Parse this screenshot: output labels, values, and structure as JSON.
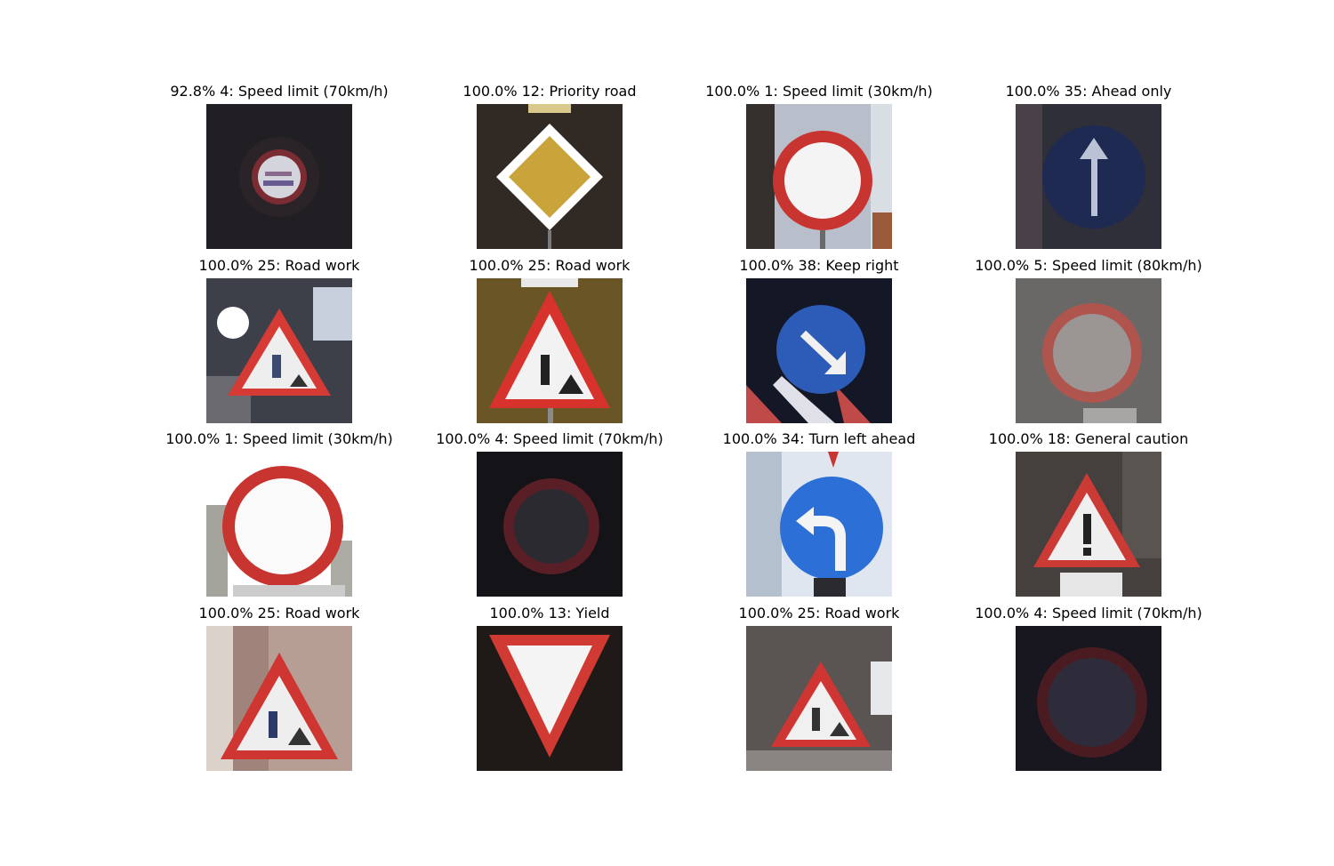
{
  "figure": {
    "panels": [
      {
        "caption": "92.8% 4: Speed limit (70km/h)",
        "confidence": 92.8,
        "class_id": 4,
        "class_name": "Speed limit (70km/h)",
        "icon": "speed-limit-70-sign-icon"
      },
      {
        "caption": "100.0% 12: Priority road",
        "confidence": 100.0,
        "class_id": 12,
        "class_name": "Priority road",
        "icon": "priority-road-sign-icon"
      },
      {
        "caption": "100.0% 1: Speed limit (30km/h)",
        "confidence": 100.0,
        "class_id": 1,
        "class_name": "Speed limit (30km/h)",
        "icon": "speed-limit-30-sign-icon"
      },
      {
        "caption": "100.0% 35: Ahead only",
        "confidence": 100.0,
        "class_id": 35,
        "class_name": "Ahead only",
        "icon": "ahead-only-sign-icon"
      },
      {
        "caption": "100.0% 25: Road work",
        "confidence": 100.0,
        "class_id": 25,
        "class_name": "Road work",
        "icon": "road-work-sign-icon"
      },
      {
        "caption": "100.0% 25: Road work",
        "confidence": 100.0,
        "class_id": 25,
        "class_name": "Road work",
        "icon": "road-work-sign-icon"
      },
      {
        "caption": "100.0% 38: Keep right",
        "confidence": 100.0,
        "class_id": 38,
        "class_name": "Keep right",
        "icon": "keep-right-sign-icon"
      },
      {
        "caption": "100.0% 5: Speed limit (80km/h)",
        "confidence": 100.0,
        "class_id": 5,
        "class_name": "Speed limit (80km/h)",
        "icon": "speed-limit-80-sign-icon"
      },
      {
        "caption": "100.0% 1: Speed limit (30km/h)",
        "confidence": 100.0,
        "class_id": 1,
        "class_name": "Speed limit (30km/h)",
        "icon": "speed-limit-30-sign-icon"
      },
      {
        "caption": "100.0% 4: Speed limit (70km/h)",
        "confidence": 100.0,
        "class_id": 4,
        "class_name": "Speed limit (70km/h)",
        "icon": "speed-limit-70-sign-icon"
      },
      {
        "caption": "100.0% 34: Turn left ahead",
        "confidence": 100.0,
        "class_id": 34,
        "class_name": "Turn left ahead",
        "icon": "turn-left-ahead-sign-icon"
      },
      {
        "caption": "100.0% 18: General caution",
        "confidence": 100.0,
        "class_id": 18,
        "class_name": "General caution",
        "icon": "general-caution-sign-icon"
      },
      {
        "caption": "100.0% 25: Road work",
        "confidence": 100.0,
        "class_id": 25,
        "class_name": "Road work",
        "icon": "road-work-sign-icon"
      },
      {
        "caption": "100.0% 13: Yield",
        "confidence": 100.0,
        "class_id": 13,
        "class_name": "Yield",
        "icon": "yield-sign-icon"
      },
      {
        "caption": "100.0% 25: Road work",
        "confidence": 100.0,
        "class_id": 25,
        "class_name": "Road work",
        "icon": "road-work-sign-icon"
      },
      {
        "caption": "100.0% 4: Speed limit (70km/h)",
        "confidence": 100.0,
        "class_id": 4,
        "class_name": "Speed limit (70km/h)",
        "icon": "speed-limit-70-sign-icon"
      }
    ],
    "colors": {
      "sign_red": "#c8342f",
      "sign_blue": "#2d5fbf",
      "sign_yellow": "#c9a43a",
      "dark_bg": "#1c1b22"
    }
  }
}
